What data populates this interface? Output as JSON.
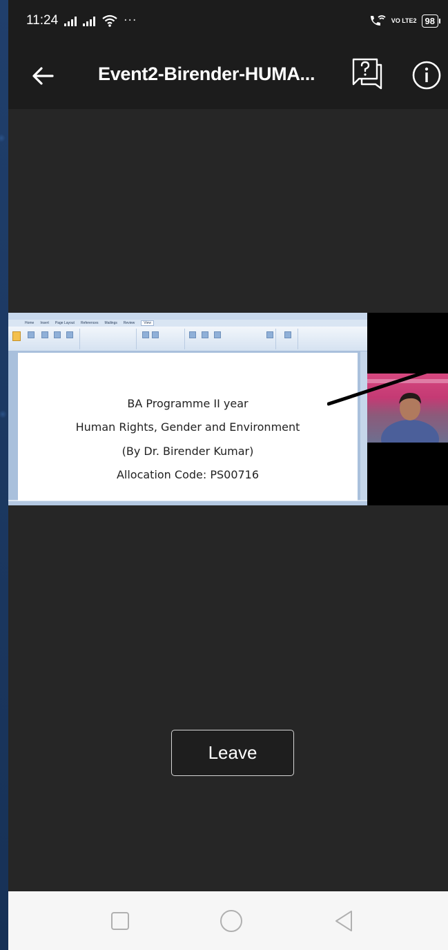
{
  "status_bar": {
    "time": "11:24",
    "more": "···",
    "network": "VO LTE2",
    "battery": "98"
  },
  "app_bar": {
    "title": "Event2-Birender-HUMA..."
  },
  "shared_screen": {
    "ribbon_tabs": [
      "Home",
      "Insert",
      "Page Layout",
      "References",
      "Mailings",
      "Review",
      "View"
    ],
    "active_tab": "View",
    "document_lines": [
      "BA Programme II year",
      "Human Rights, Gender and Environment",
      "(By Dr. Birender Kumar)",
      "Allocation Code: PS00716"
    ]
  },
  "leave_button": {
    "label": "Leave"
  },
  "colors": {
    "background": "#262626",
    "bars": "#1c1c1c",
    "navbar": "#f6f6f6"
  }
}
